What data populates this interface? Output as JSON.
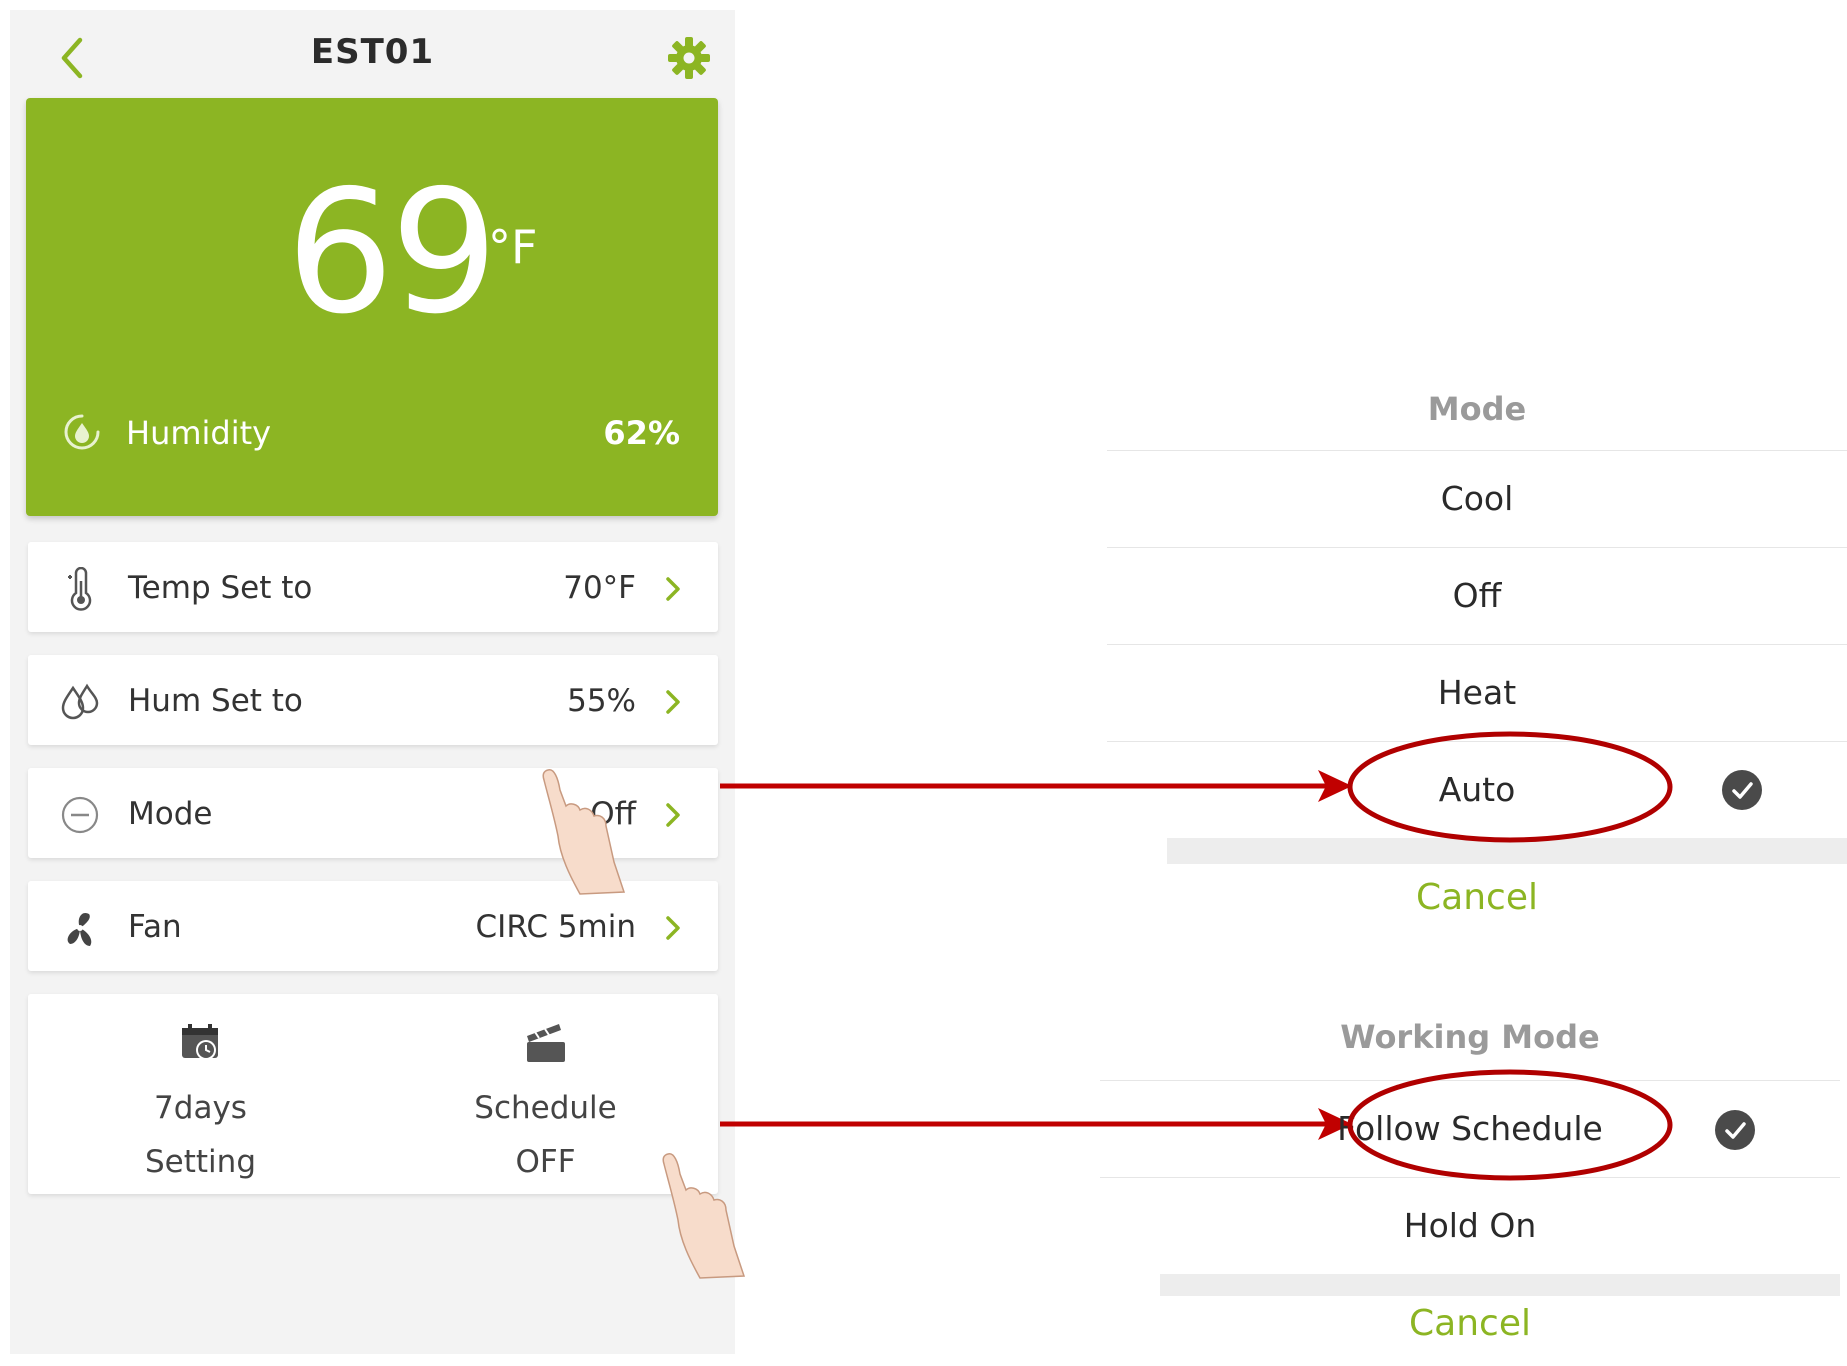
{
  "header": {
    "title": "EST01",
    "back_icon": "chevron-left-icon",
    "settings_icon": "gear-icon",
    "accent_color": "#8cb523"
  },
  "hero": {
    "temperature": "69",
    "unit": "°F",
    "humidity_label": "Humidity",
    "humidity_value": "62%",
    "background_color": "#8cb523"
  },
  "rows": [
    {
      "label": "Temp Set to",
      "value": "70°F",
      "icon": "thermometer-icon"
    },
    {
      "label": "Hum Set to",
      "value": "55%",
      "icon": "drops-icon"
    },
    {
      "label": "Mode",
      "value": "Off",
      "icon": "minus-circle-icon"
    },
    {
      "label": "Fan",
      "value": "CIRC 5min",
      "icon": "fan-icon"
    }
  ],
  "tiles": [
    {
      "line1": "7days",
      "line2": "Setting",
      "icon": "calendar-clock-icon"
    },
    {
      "line1": "Schedule",
      "line2": "OFF",
      "icon": "clapperboard-icon"
    }
  ],
  "mode_sheet": {
    "title": "Mode",
    "options": [
      "Cool",
      "Off",
      "Heat",
      "Auto"
    ],
    "selected": "Auto",
    "cancel": "Cancel"
  },
  "working_mode_sheet": {
    "title": "Working Mode",
    "options": [
      "Follow Schedule",
      "Hold On"
    ],
    "selected": "Follow Schedule",
    "cancel": "Cancel"
  },
  "annotation_color": "#c00000"
}
